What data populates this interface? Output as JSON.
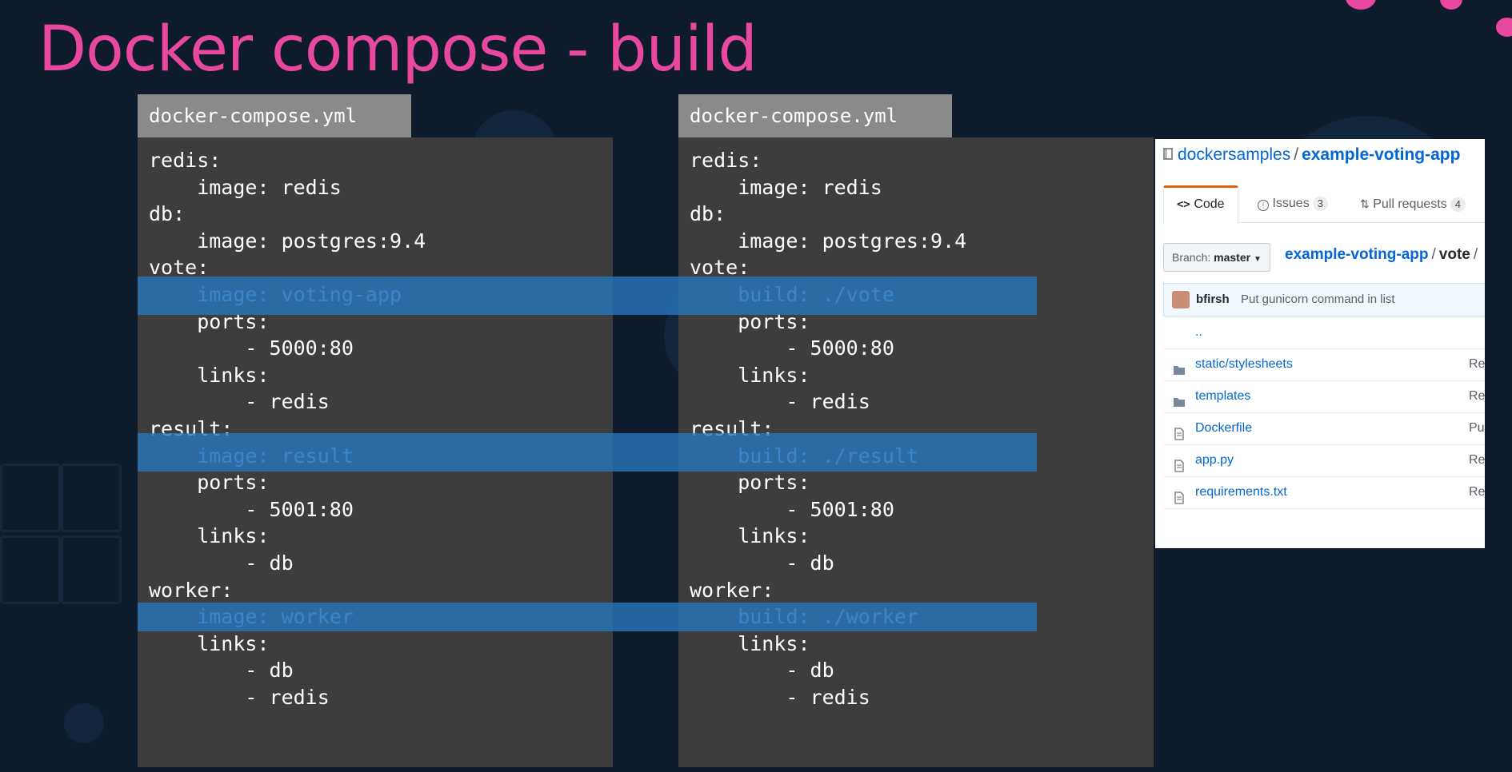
{
  "slide": {
    "title": "Docker compose - build"
  },
  "left_file": {
    "tab": "docker-compose.yml",
    "lines": [
      {
        "text": "redis:",
        "hl": false
      },
      {
        "text": "    image: redis",
        "hl": false
      },
      {
        "text": "db:",
        "hl": false
      },
      {
        "text": "    image: postgres:9.4",
        "hl": false
      },
      {
        "text": "vote:",
        "hl": false
      },
      {
        "text": "    image: voting-app",
        "hl": true
      },
      {
        "text": "    ports:",
        "hl": false
      },
      {
        "text": "        - 5000:80",
        "hl": false
      },
      {
        "text": "    links:",
        "hl": false
      },
      {
        "text": "        - redis",
        "hl": false
      },
      {
        "text": "result:",
        "hl": false
      },
      {
        "text": "    image: result",
        "hl": true
      },
      {
        "text": "    ports:",
        "hl": false
      },
      {
        "text": "        - 5001:80",
        "hl": false
      },
      {
        "text": "    links:",
        "hl": false
      },
      {
        "text": "        - db",
        "hl": false
      },
      {
        "text": "worker:",
        "hl": false
      },
      {
        "text": "    image: worker",
        "hl": true
      },
      {
        "text": "    links:",
        "hl": false
      },
      {
        "text": "        - db",
        "hl": false
      },
      {
        "text": "        - redis",
        "hl": false
      }
    ]
  },
  "right_file": {
    "tab": "docker-compose.yml",
    "lines": [
      {
        "text": "redis:",
        "hl": false
      },
      {
        "text": "    image: redis",
        "hl": false
      },
      {
        "text": "db:",
        "hl": false
      },
      {
        "text": "    image: postgres:9.4",
        "hl": false
      },
      {
        "text": "vote:",
        "hl": false
      },
      {
        "text": "    build: ./vote",
        "hl": true
      },
      {
        "text": "    ports:",
        "hl": false
      },
      {
        "text": "        - 5000:80",
        "hl": false
      },
      {
        "text": "    links:",
        "hl": false
      },
      {
        "text": "        - redis",
        "hl": false
      },
      {
        "text": "result:",
        "hl": false
      },
      {
        "text": "    build: ./result",
        "hl": true
      },
      {
        "text": "    ports:",
        "hl": false
      },
      {
        "text": "        - 5001:80",
        "hl": false
      },
      {
        "text": "    links:",
        "hl": false
      },
      {
        "text": "        - db",
        "hl": false
      },
      {
        "text": "worker:",
        "hl": false
      },
      {
        "text": "    build: ./worker",
        "hl": true
      },
      {
        "text": "    links:",
        "hl": false
      },
      {
        "text": "        - db",
        "hl": false
      },
      {
        "text": "        - redis",
        "hl": false
      }
    ]
  },
  "github": {
    "owner": "dockersamples",
    "separator": "/",
    "repo": "example-voting-app",
    "tabs": {
      "code": "Code",
      "issues": "Issues",
      "issues_count": "3",
      "pulls": "Pull requests",
      "pulls_count": "4"
    },
    "branch_prefix": "Branch:",
    "branch": "master",
    "path_repo": "example-voting-app",
    "path_dir": "vote",
    "commit": {
      "author": "bfirsh",
      "message": "Put gunicorn command in list"
    },
    "parent_dir": "..",
    "files": [
      {
        "name": "static/stylesheets",
        "type": "dir",
        "msg": "Re"
      },
      {
        "name": "templates",
        "type": "dir",
        "msg": "Re"
      },
      {
        "name": "Dockerfile",
        "type": "file",
        "msg": "Pu"
      },
      {
        "name": "app.py",
        "type": "file",
        "msg": "Re"
      },
      {
        "name": "requirements.txt",
        "type": "file",
        "msg": "Re"
      }
    ]
  },
  "colors": {
    "background": "#0d1b2a",
    "title": "#e8489e",
    "highlight": "#2875be",
    "link": "#0366d6"
  }
}
